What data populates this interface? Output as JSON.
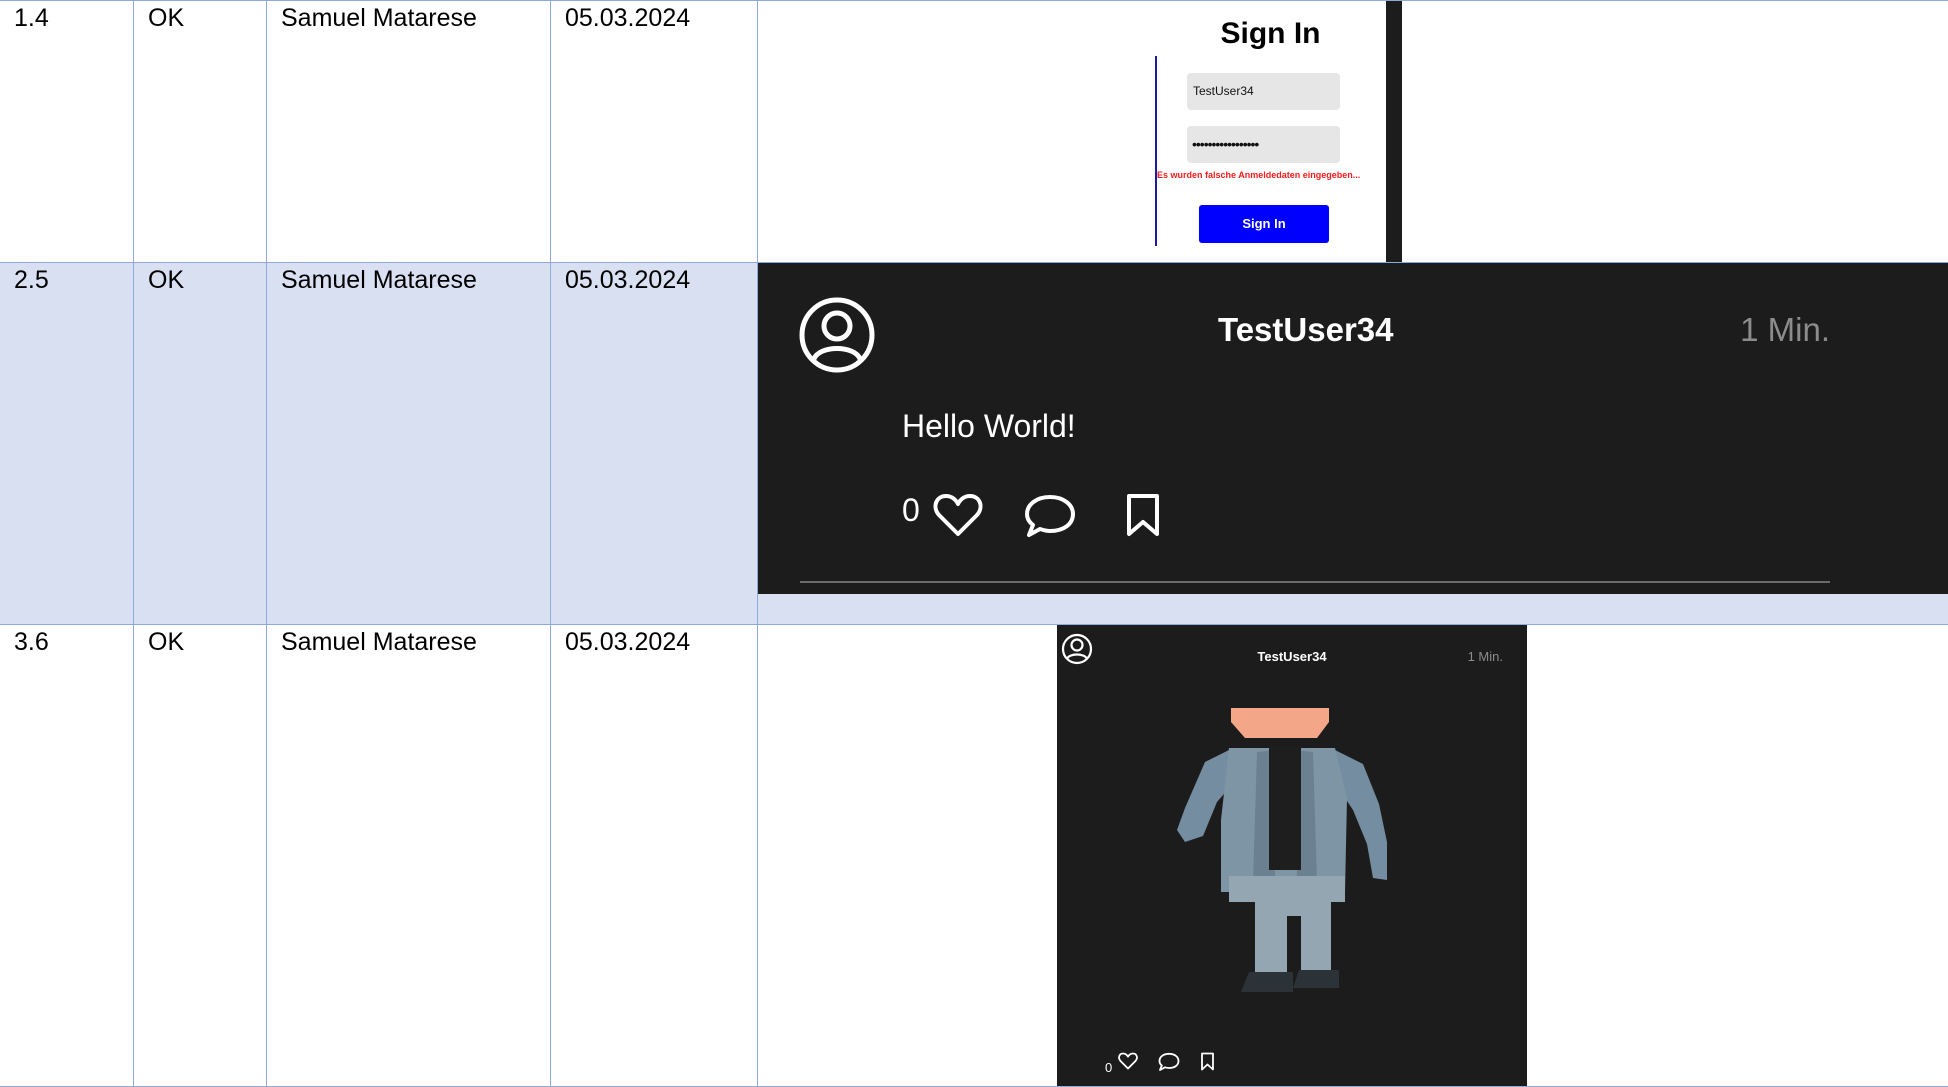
{
  "rows": [
    {
      "id": "1.4",
      "status": "OK",
      "tester": "Samuel Matarese",
      "date": "05.03.2024",
      "screenshot": {
        "title": "Sign In",
        "username_value": "TestUser34",
        "password_value": "•••••••••••••••••",
        "error_message": "Es wurden falsche Anmeldedaten eingegeben...",
        "button_label": "Sign In"
      }
    },
    {
      "id": "2.5",
      "status": "OK",
      "tester": "Samuel Matarese",
      "date": "05.03.2024",
      "screenshot": {
        "username": "TestUser34",
        "time": "1 Min.",
        "text": "Hello World!",
        "likes": "0"
      }
    },
    {
      "id": "3.6",
      "status": "OK",
      "tester": "Samuel Matarese",
      "date": "05.03.2024",
      "screenshot": {
        "username": "TestUser34",
        "time": "1 Min.",
        "likes": "0"
      }
    }
  ],
  "colors": {
    "table_border": "#8eaadb",
    "row_shade": "#d9e0f2",
    "app_background": "#1c1c1c",
    "error_text": "#ff1a1a",
    "signin_button": "#0000ff",
    "muted_text": "#8c8c8c"
  },
  "icons": [
    "user-avatar-icon",
    "heart-icon",
    "comment-icon",
    "bookmark-icon"
  ]
}
